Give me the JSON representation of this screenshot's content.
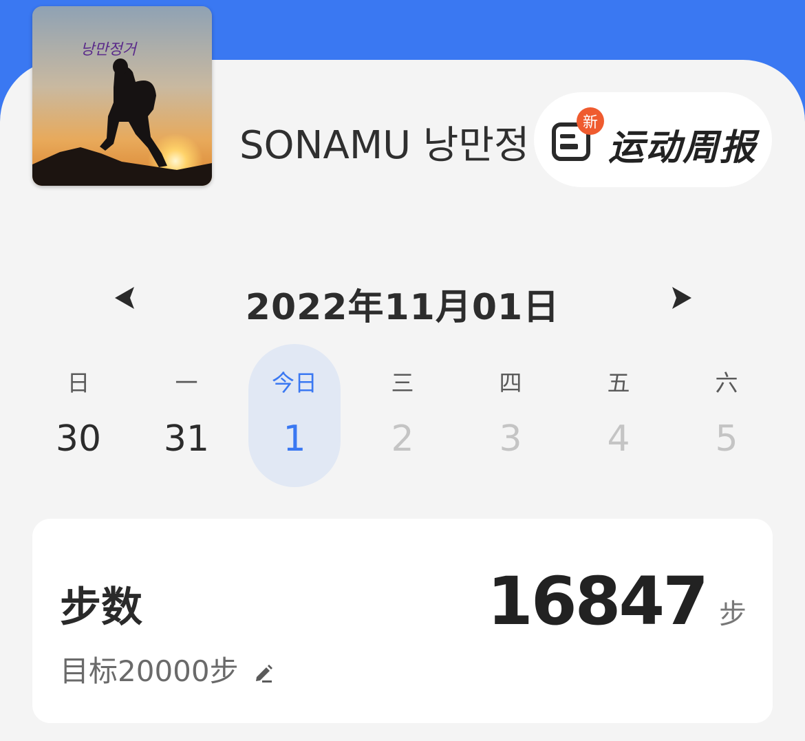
{
  "profile": {
    "username": "SONAMU 낭만정",
    "avatar_caption": "낭만정거"
  },
  "weekly_report": {
    "badge": "新",
    "label": "运动周报",
    "icon": "report-doc-icon"
  },
  "date_nav": {
    "title": "2022年11月01日",
    "prev_icon": "triangle-left-icon",
    "next_icon": "triangle-right-icon"
  },
  "week": [
    {
      "weekday": "日",
      "day": "30"
    },
    {
      "weekday": "一",
      "day": "31"
    },
    {
      "weekday": "今日",
      "day": "1"
    },
    {
      "weekday": "三",
      "day": "2"
    },
    {
      "weekday": "四",
      "day": "3"
    },
    {
      "weekday": "五",
      "day": "4"
    },
    {
      "weekday": "六",
      "day": "5"
    }
  ],
  "steps": {
    "title": "步数",
    "value": "16847",
    "unit": "步",
    "goal": "目标20000步",
    "edit_icon": "pencil-icon"
  },
  "colors": {
    "accent": "#3a78f2",
    "badge": "#ef5b2f",
    "background": "#f4f4f4"
  }
}
